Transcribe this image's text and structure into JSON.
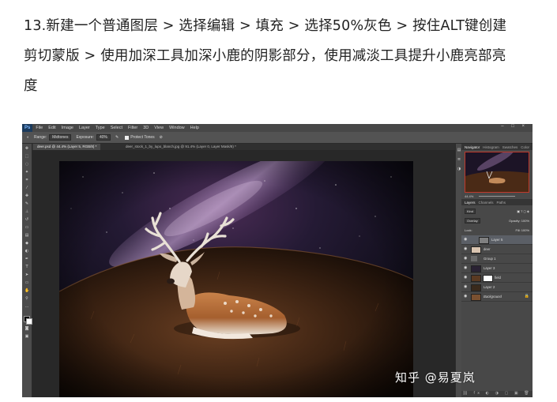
{
  "instructions": {
    "line1": "13.新建一个普通图层 > 选择编辑 > 填充 > 选择50%灰色 > 按住ALT键创建",
    "line2": "剪切蒙版 > 使用加深工具加深小鹿的阴影部分，使用减淡工具提升小鹿亮部亮",
    "line3": "度"
  },
  "photoshop": {
    "logo": "Ps",
    "menu": [
      "File",
      "Edit",
      "Image",
      "Layer",
      "Type",
      "Select",
      "Filter",
      "3D",
      "View",
      "Window",
      "Help"
    ],
    "window_controls": "– □ ×",
    "options": {
      "range_label": "Range:",
      "range_value": "Midtones",
      "exposure_label": "Exposure:",
      "exposure_value": "40%",
      "protect_tones": "Protect Tones"
    },
    "tabs": [
      "deer.psd @ 44.4% (Layer 5, RGB/8) *",
      "deer_stock_1_by_lupo_blanch.jpg @ 91.4% (Layer 0, Layer Mask/8) *"
    ],
    "panels": {
      "nav_tabs": [
        "Navigator",
        "Histogram",
        "Swatches",
        "Color"
      ],
      "zoom": "44.4%",
      "layer_tabs": [
        "Layers",
        "Channels",
        "Paths"
      ],
      "kind": "Kind",
      "blend_mode": "Overlay",
      "opacity": "Opacity: 100%",
      "fill": "Fill: 100%",
      "lock": "Lock:",
      "layers": [
        {
          "name": "Layer 5",
          "selected": true,
          "has_mask": false
        },
        {
          "name": "deer",
          "selected": false,
          "has_mask": false
        },
        {
          "name": "Group 1",
          "selected": false,
          "has_mask": false
        },
        {
          "name": "Layer 3",
          "selected": false,
          "has_mask": false
        },
        {
          "name": "field",
          "selected": false,
          "has_mask": true
        },
        {
          "name": "Layer 2",
          "selected": false,
          "has_mask": false
        },
        {
          "name": "Background",
          "selected": false,
          "has_mask": false
        }
      ]
    }
  },
  "watermark": "知乎 @易夏岚"
}
